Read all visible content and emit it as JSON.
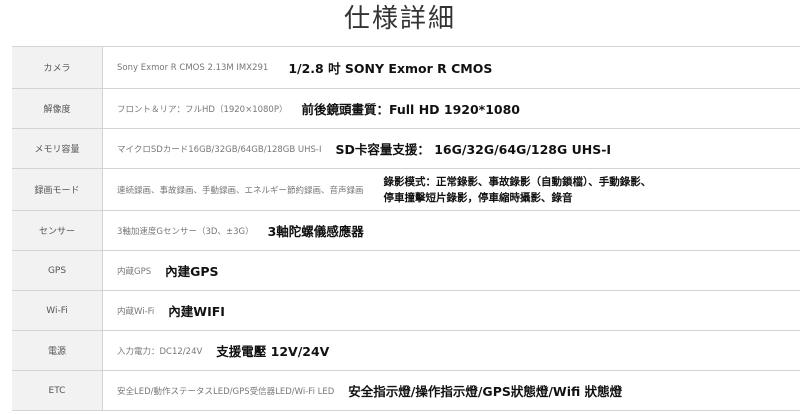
{
  "page_title": "仕様詳細",
  "rows": [
    {
      "label": "カメラ",
      "jp": "Sony Exmor R CMOS 2.13M IMX291",
      "zh": "1/2.8 吋 SONY Exmor R CMOS"
    },
    {
      "label": "解像度",
      "jp": "フロント＆リア：フルHD（1920×1080P）",
      "zh": "前後鏡頭畫質：Full HD 1920*1080"
    },
    {
      "label": "メモリ容量",
      "jp": "マイクロSDカード16GB/32GB/64GB/128GB UHS-I",
      "zh": "SD卡容量支援： 16G/32G/64G/128G UHS-I"
    },
    {
      "label": "録画モード",
      "jp": "連続録画、事故録画、手動録画、エネルギー節約録画、音声録画",
      "zh_line1": "錄影模式：正常錄影、事故錄影（自動鎖檔）、手動錄影、",
      "zh_line2": "停車撞擊短片錄影，停車縮時攝影、錄音"
    },
    {
      "label": "センサー",
      "jp": "3軸加速度Gセンサー（3D、±3G）",
      "zh": "3軸陀螺儀感應器"
    },
    {
      "label": "GPS",
      "jp": "内蔵GPS",
      "zh": "內建GPS"
    },
    {
      "label": "Wi-Fi",
      "jp": "内蔵Wi-Fi",
      "zh": "內建WIFI"
    },
    {
      "label": "電源",
      "jp": "入力電力：DC12/24V",
      "zh": "支援電壓 12V/24V"
    },
    {
      "label": "ETC",
      "jp": "安全LED/動作ステータスLED/GPS受信器LED/Wi-Fi LED",
      "zh": "安全指示燈/操作指示燈/GPS狀態燈/Wifi 狀態燈"
    }
  ]
}
